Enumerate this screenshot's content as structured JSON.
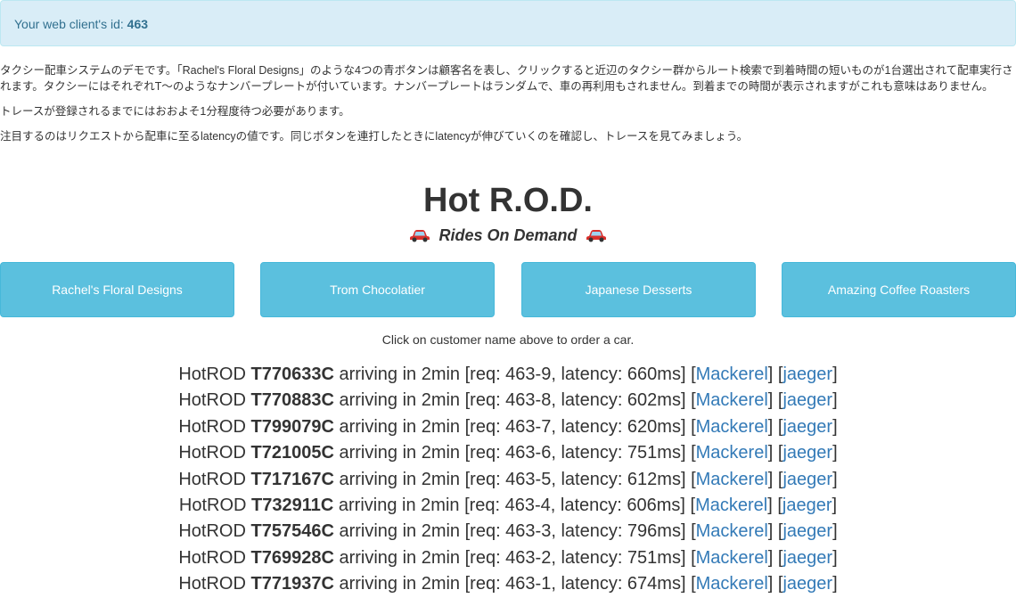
{
  "alert": {
    "prefix": "Your web client's id:",
    "client_id": "463"
  },
  "intro": {
    "p1": "タクシー配車システムのデモです。「Rachel's Floral Designs」のような4つの青ボタンは顧客名を表し、クリックすると近辺のタクシー群からルート検索で到着時間の短いものが1台選出されて配車実行されます。タクシーにはそれぞれT〜のようなナンバープレートが付いています。ナンバープレートはランダムで、車の再利用もされません。到着までの時間が表示されますがこれも意味はありません。",
    "p2": "トレースが登録されるまでにはおおよそ1分程度待つ必要があります。",
    "p3": "注目するのはリクエストから配車に至るlatencyの値です。同じボタンを連打したときにlatencyが伸びていくのを確認し、トレースを見てみましょう。"
  },
  "header": {
    "title": "Hot R.O.D.",
    "subtitle": "Rides On Demand"
  },
  "customers": [
    {
      "label": "Rachel's Floral Designs"
    },
    {
      "label": "Trom Chocolatier"
    },
    {
      "label": "Japanese Desserts"
    },
    {
      "label": "Amazing Coffee Roasters"
    }
  ],
  "hint": "Click on customer name above to order a car.",
  "link_labels": {
    "mackerel": "Mackerel",
    "jaeger": "jaeger"
  },
  "rides": [
    {
      "plate": "T770633C",
      "eta": "2min",
      "req": "463-9",
      "latency": "660ms"
    },
    {
      "plate": "T770883C",
      "eta": "2min",
      "req": "463-8",
      "latency": "602ms"
    },
    {
      "plate": "T799079C",
      "eta": "2min",
      "req": "463-7",
      "latency": "620ms"
    },
    {
      "plate": "T721005C",
      "eta": "2min",
      "req": "463-6",
      "latency": "751ms"
    },
    {
      "plate": "T717167C",
      "eta": "2min",
      "req": "463-5",
      "latency": "612ms"
    },
    {
      "plate": "T732911C",
      "eta": "2min",
      "req": "463-4",
      "latency": "606ms"
    },
    {
      "plate": "T757546C",
      "eta": "2min",
      "req": "463-3",
      "latency": "796ms"
    },
    {
      "plate": "T769928C",
      "eta": "2min",
      "req": "463-2",
      "latency": "751ms"
    },
    {
      "plate": "T771937C",
      "eta": "2min",
      "req": "463-1",
      "latency": "674ms"
    }
  ],
  "colors": {
    "button": "#5bc0de",
    "alert_bg": "#d9edf7",
    "link": "#337ab7"
  }
}
